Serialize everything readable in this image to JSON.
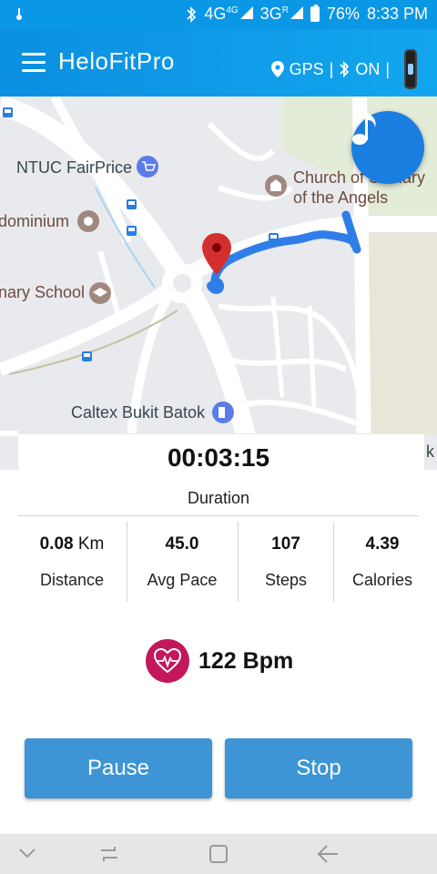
{
  "status_bar": {
    "network_1": "4G",
    "network_1_sup": "4G",
    "network_2": "3G",
    "network_2_sup": "R",
    "battery": "76%",
    "time": "8:33 PM"
  },
  "app_bar": {
    "title": "HeloFitPro",
    "gps_label": "GPS",
    "separator": "|",
    "bluetooth_state": "ON"
  },
  "map": {
    "labels": {
      "ntuc": "NTUC FairPrice",
      "church_line1": "Church of St Mary",
      "church_line2": "of the Angels",
      "condominium": "dominium",
      "school": "nary School",
      "caltex": "Caltex Bukit Batok",
      "edge_k": "k"
    },
    "music_icon": "music-note-icon"
  },
  "workout": {
    "duration_value": "00:03:15",
    "duration_label": "Duration",
    "distance": {
      "value": "0.08",
      "unit": "Km",
      "label": "Distance"
    },
    "avg_pace": {
      "value": "45.0",
      "label": "Avg Pace"
    },
    "steps": {
      "value": "107",
      "label": "Steps"
    },
    "calories": {
      "value": "4.39",
      "label": "Calories"
    },
    "heart_rate": "122 Bpm"
  },
  "actions": {
    "pause_label": "Pause",
    "stop_label": "Stop"
  },
  "colors": {
    "primary": "#0a97e6",
    "button": "#3d95d6",
    "heart": "#c2185b",
    "route": "#2f7ee8",
    "music_fab": "#1a7ee0"
  }
}
